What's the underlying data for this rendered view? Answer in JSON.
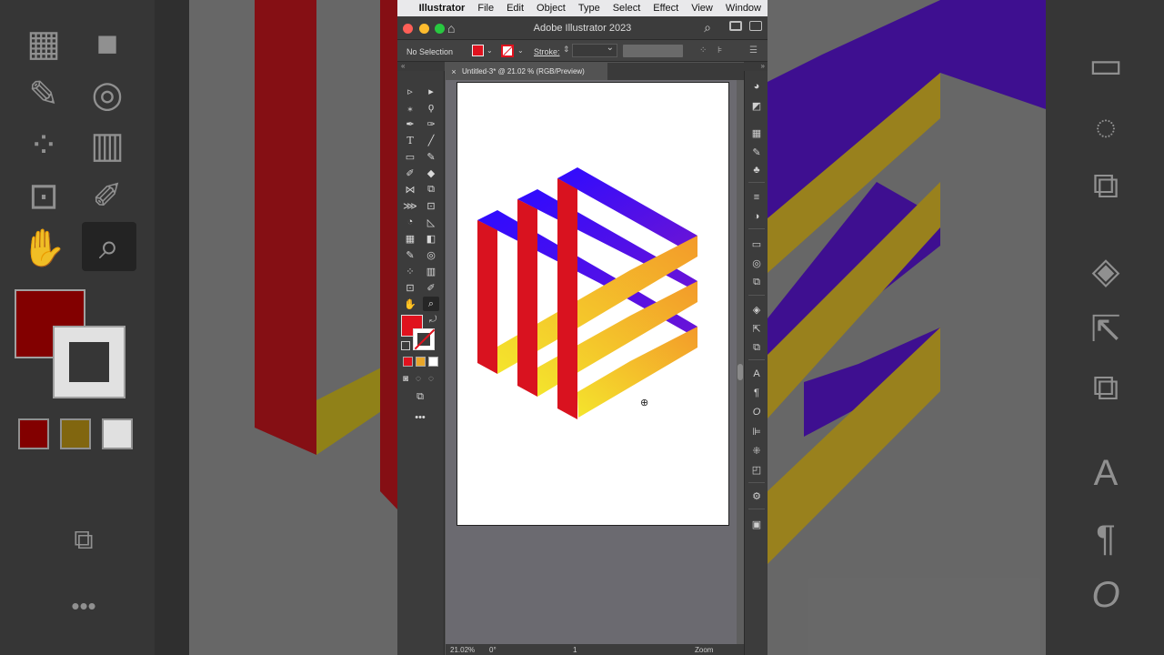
{
  "menubar": {
    "app_name": "Illustrator",
    "items": [
      "File",
      "Edit",
      "Object",
      "Type",
      "Select",
      "Effect",
      "View",
      "Window"
    ]
  },
  "window": {
    "title": "Adobe Illustrator 2023"
  },
  "control_bar": {
    "selection": "No Selection",
    "stroke_label": "Stroke:"
  },
  "document_tab": {
    "title": "Untitled-3* @ 21.02 % (RGB/Preview)"
  },
  "status_bar": {
    "zoom": "21.02%",
    "rotation": "0°",
    "artboard": "1",
    "tool": "Zoom"
  },
  "colors": {
    "fill": "#e0121e",
    "artwork_red": "#d9121f",
    "artwork_blue_start": "#2f0bff",
    "artwork_blue_end": "#6a14d6",
    "artwork_yellow": "#f4e52c",
    "artwork_orange": "#f39a2a"
  },
  "icons": {
    "tools": [
      "selection-tool",
      "direct-selection-tool",
      "magic-wand-tool",
      "lasso-tool",
      "pen-tool",
      "curvature-tool",
      "type-tool",
      "line-tool",
      "rectangle-tool",
      "paintbrush-tool",
      "blob-brush-tool",
      "eraser-tool",
      "reflect-tool",
      "scale-tool",
      "width-tool",
      "free-transform-tool",
      "shape-builder-tool",
      "perspective-grid-tool",
      "mesh-tool",
      "gradient-tool",
      "eyedropper-tool",
      "blend-tool",
      "symbol-sprayer-tool",
      "graph-tool",
      "artboard-tool",
      "slice-tool",
      "hand-tool",
      "zoom-tool"
    ],
    "dock": [
      "color-guide-icon",
      "color-icon",
      "swatches-icon",
      "brushes-icon",
      "symbols-icon",
      "stroke-icon",
      "transparency-icon",
      "gradient-icon",
      "appearance-icon",
      "graphic-styles-icon",
      "layers-icon",
      "export-icon",
      "artboards-icon",
      "character-icon",
      "paragraph-icon",
      "opentype-icon",
      "align-icon",
      "transform-icon",
      "pathfinder-icon",
      "properties-icon",
      "libraries-icon"
    ]
  }
}
